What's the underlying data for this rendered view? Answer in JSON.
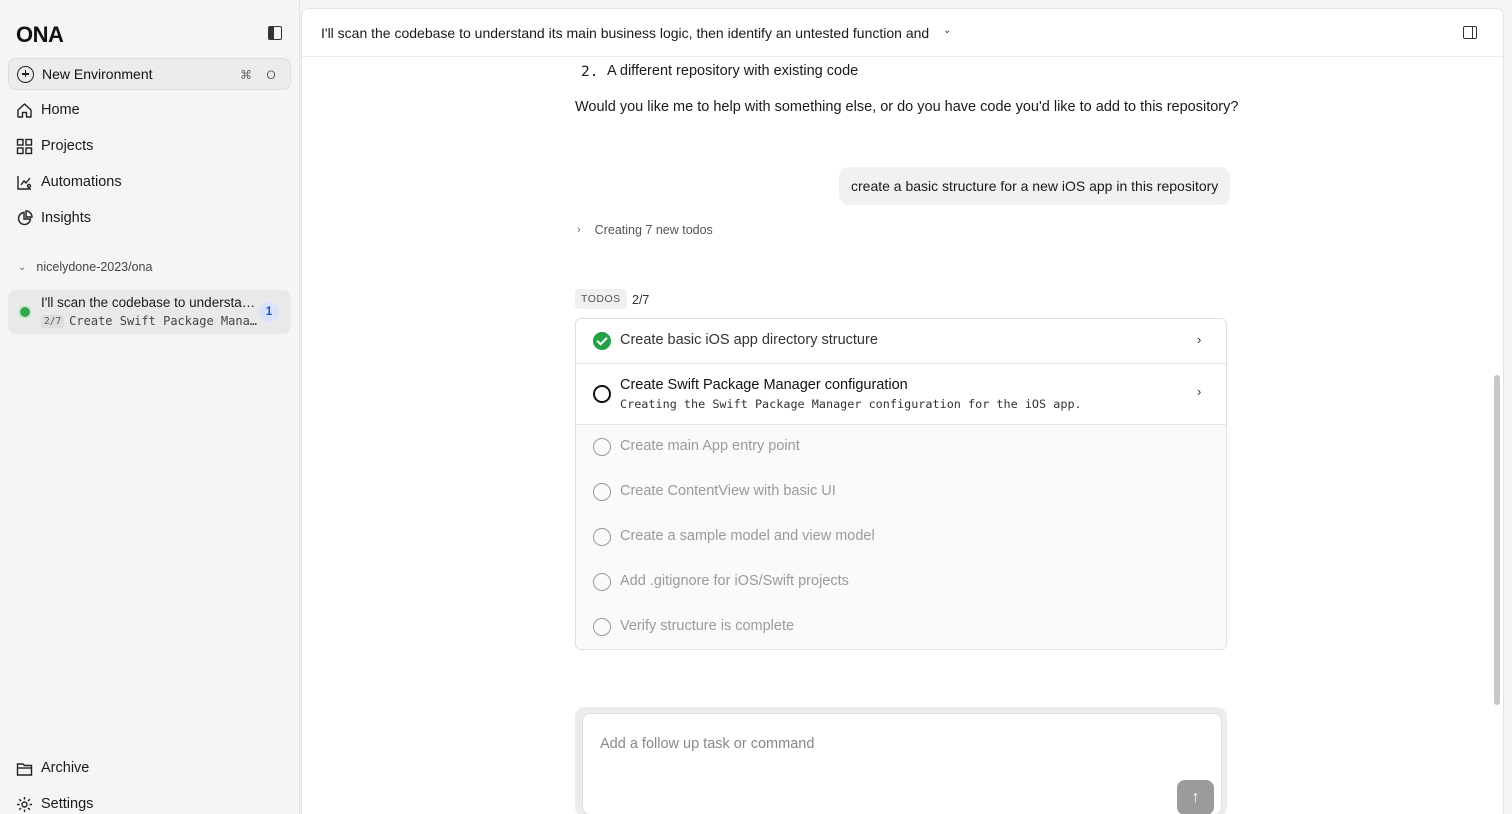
{
  "sidebar": {
    "logo": "ONA",
    "new_environment": {
      "label": "New Environment",
      "shortcut_mod": "⌘",
      "shortcut_key": "O"
    },
    "nav": {
      "home": "Home",
      "projects": "Projects",
      "automations": "Automations",
      "insights": "Insights"
    },
    "group": {
      "label": "nicelydone-2023/ona"
    },
    "environment": {
      "title": "I'll scan the codebase to understand its main business logic, then identify an untested function and",
      "progress": "2/7",
      "subtitle": "Create Swift Package Manager configuration",
      "badge": "1",
      "status_color": "#2fa84f"
    },
    "bottom": {
      "archive": "Archive",
      "settings": "Settings"
    }
  },
  "header": {
    "title": "I'll scan the codebase to understand its main business logic, then identify an untested function and"
  },
  "conversation": {
    "list_item": {
      "number": "2.",
      "text": "A different repository with existing code"
    },
    "paragraph": "Would you like me to help with something else, or do you have code you'd like to add to this repository?",
    "user_message": "create a basic structure for a new iOS app in this repository",
    "creating_label": "Creating 7 new todos"
  },
  "todos": {
    "tag": "TODOS",
    "count": "2/7",
    "items": [
      {
        "label": "Create basic iOS app directory structure",
        "status": "done"
      },
      {
        "label": "Create Swift Package Manager configuration",
        "status": "in-progress",
        "detail": "Creating the Swift Package Manager configuration for the iOS app."
      },
      {
        "label": "Create main App entry point",
        "status": "pending"
      },
      {
        "label": "Create ContentView with basic UI",
        "status": "pending"
      },
      {
        "label": "Create a sample model and view model",
        "status": "pending"
      },
      {
        "label": "Add .gitignore for iOS/Swift projects",
        "status": "pending"
      },
      {
        "label": "Verify structure is complete",
        "status": "pending"
      }
    ]
  },
  "composer": {
    "placeholder": "Add a follow up task or command"
  },
  "colors": {
    "success": "#24a148",
    "badge_bg": "#d8e3fb",
    "badge_text": "#2752c7"
  }
}
